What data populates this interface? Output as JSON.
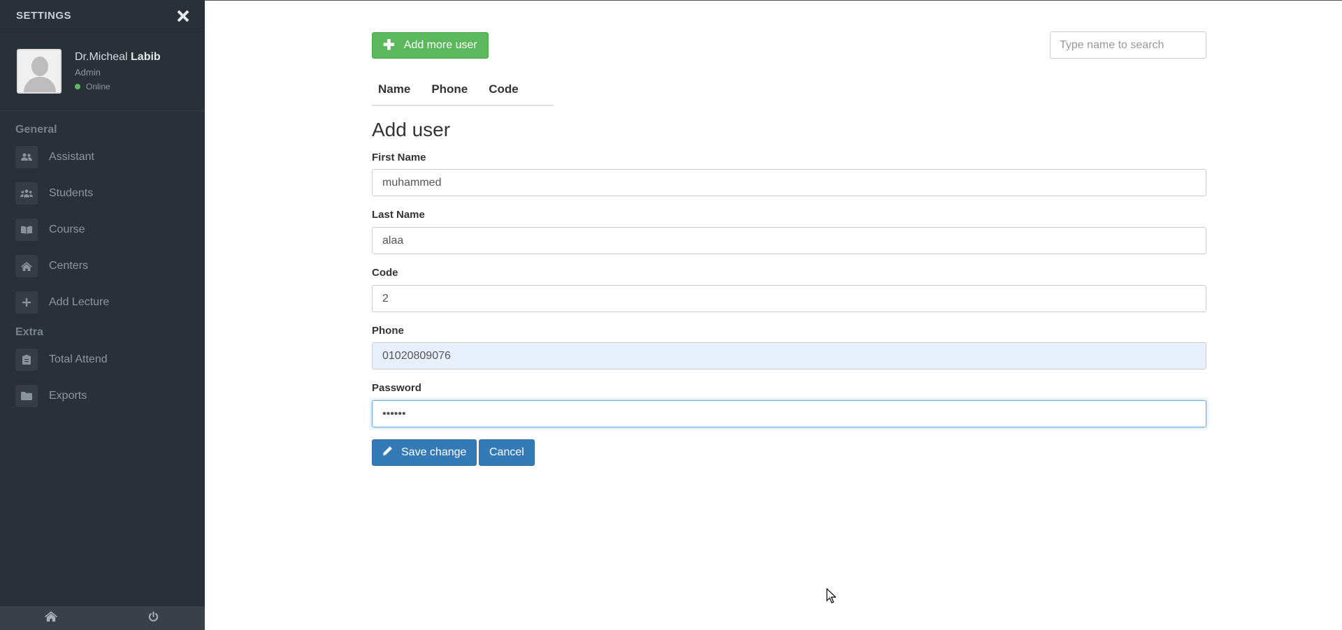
{
  "sidebar": {
    "title": "SETTINGS",
    "profile": {
      "name_prefix": "Dr.Micheal",
      "name_bold": "Labib",
      "role": "Admin",
      "status": "Online"
    },
    "sections": [
      {
        "label": "General",
        "items": [
          {
            "label": "Assistant",
            "icon": "users-icon"
          },
          {
            "label": "Students",
            "icon": "group-icon"
          },
          {
            "label": "Course",
            "icon": "book-icon"
          },
          {
            "label": "Centers",
            "icon": "home-icon"
          },
          {
            "label": "Add Lecture",
            "icon": "plus-icon"
          }
        ]
      },
      {
        "label": "Extra",
        "items": [
          {
            "label": "Total Attend",
            "icon": "clipboard-icon"
          },
          {
            "label": "Exports",
            "icon": "folder-icon"
          }
        ]
      }
    ],
    "footer": {
      "home_icon": "home-icon",
      "power_icon": "power-icon"
    }
  },
  "toolbar": {
    "add_button": "Add more user",
    "search_placeholder": "Type name to search"
  },
  "table": {
    "columns": [
      "Name",
      "Phone",
      "Code"
    ]
  },
  "form": {
    "title": "Add user",
    "fields": {
      "first_name": {
        "label": "First Name",
        "value": "muhammed"
      },
      "last_name": {
        "label": "Last Name",
        "value": "alaa"
      },
      "code": {
        "label": "Code",
        "value": "2"
      },
      "phone": {
        "label": "Phone",
        "value": "01020809076"
      },
      "password": {
        "label": "Password",
        "value": "••••••"
      }
    },
    "save_label": "Save change",
    "cancel_label": "Cancel"
  },
  "colors": {
    "sidebar_bg": "#2a3038",
    "success": "#5cb85c",
    "primary": "#337ab7",
    "online": "#5cb85c"
  }
}
